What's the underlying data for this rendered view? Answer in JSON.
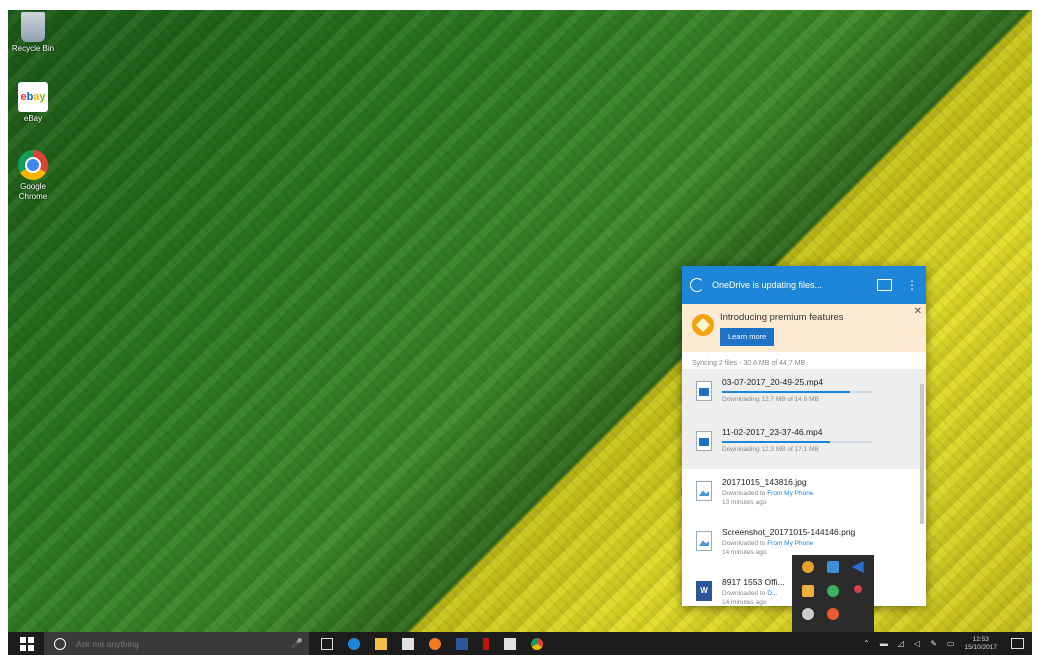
{
  "desktop": {
    "icons": [
      {
        "label": "Recycle Bin",
        "icon": "recycle-bin-icon"
      },
      {
        "label": "eBay",
        "icon": "ebay-icon"
      },
      {
        "label": "Google Chrome",
        "icon": "chrome-icon"
      }
    ]
  },
  "onedrive": {
    "header_title": "OneDrive is updating files...",
    "promo": {
      "title": "Introducing premium features",
      "button": "Learn more"
    },
    "sync_status": "Syncing 2 files - 30.6 MB of 44.7 MB",
    "files": [
      {
        "name": "03-07-2017_20-49-25.mp4",
        "sub": "Downloading 12.7 MB of 14.9 MB",
        "progress": 0.85,
        "kind": "video"
      },
      {
        "name": "11-02-2017_23-37-46.mp4",
        "sub": "Downloading 12.3 MB of 17.1 MB",
        "progress": 0.72,
        "kind": "video"
      },
      {
        "name": "20171015_143816.jpg",
        "sub": "Downloaded to",
        "location": "From My Phone",
        "time": "13 minutes ago",
        "kind": "image"
      },
      {
        "name": "Screenshot_20171015-144146.png",
        "sub": "Downloaded to",
        "location": "From My Phone",
        "time": "14 minutes ago",
        "kind": "image"
      },
      {
        "name": "8917 1553 Offi...",
        "sub": "Downloaded to",
        "location": "D...",
        "time": "14 minutes ago",
        "kind": "word"
      }
    ]
  },
  "taskbar": {
    "search_placeholder": "Ask me anything",
    "clock_time": "12:53",
    "clock_date": "15/10/2017"
  },
  "colors": {
    "accent": "#1e86d8",
    "promo_bg": "#fdebd4",
    "taskbar": "#1c1c1c"
  }
}
